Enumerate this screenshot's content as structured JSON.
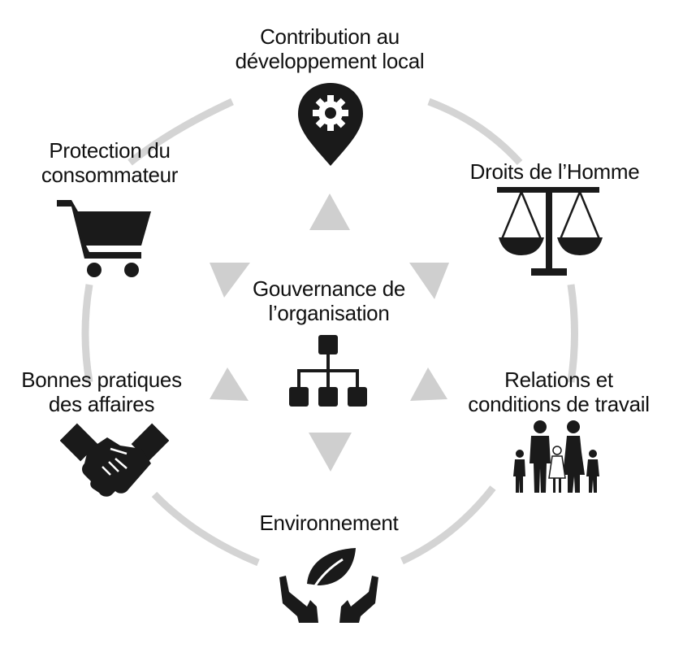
{
  "diagram": {
    "center": {
      "line1": "Gouvernance de",
      "line2": "l’organisation",
      "icon": "org-chart-icon"
    },
    "nodes": {
      "top": {
        "line1": "Contribution au",
        "line2": "développement local",
        "icon": "gear-map-pin-icon"
      },
      "top_right": {
        "line1": "Droits de l’Homme",
        "icon": "scales-of-justice-icon"
      },
      "bottom_right": {
        "line1": "Relations et",
        "line2": "conditions de travail",
        "icon": "family-people-icon"
      },
      "bottom": {
        "line1": "Environnement",
        "icon": "hands-leaf-icon"
      },
      "bottom_left": {
        "line1": "Bonnes pratiques",
        "line2": "des affaires",
        "icon": "handshake-icon"
      },
      "top_left": {
        "line1": "Protection du",
        "line2": "consommateur",
        "icon": "shopping-cart-icon"
      }
    },
    "colors": {
      "ring": "#d4d4d4",
      "arrow": "#cfcfcf",
      "icon": "#1a1a1a",
      "text": "#111111"
    }
  }
}
